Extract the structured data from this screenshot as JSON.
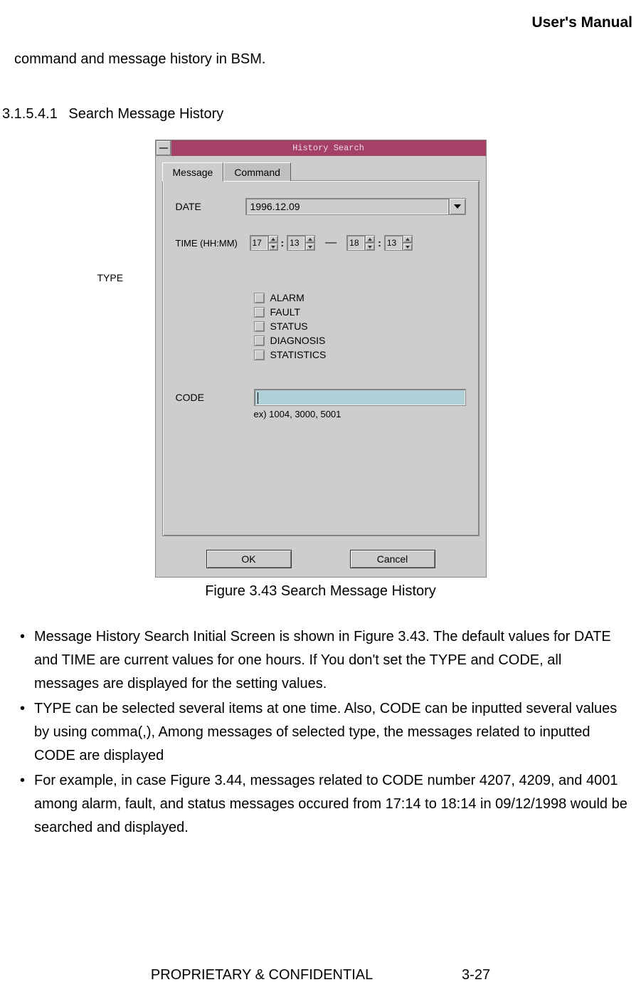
{
  "header": {
    "title": "User's Manual"
  },
  "intro": "command and message history in BSM.",
  "section": {
    "number": "3.1.5.4.1",
    "title": "Search Message History"
  },
  "window": {
    "title": "History Search",
    "tabs": [
      {
        "label": "Message",
        "active": true
      },
      {
        "label": "Command",
        "active": false
      }
    ],
    "form": {
      "date_label": "DATE",
      "date_value": "1996.12.09",
      "time_label": "TIME (HH:MM)",
      "time_from_hh": "17",
      "time_from_mm": "13",
      "time_sep": "—",
      "time_to_hh": "18",
      "time_to_mm": "13",
      "type_label": "TYPE",
      "types": [
        "ALARM",
        "FAULT",
        "STATUS",
        "DIAGNOSIS",
        "STATISTICS"
      ],
      "code_label": "CODE",
      "code_value": "",
      "code_hint": "ex) 1004, 3000, 5001"
    },
    "buttons": {
      "ok": "OK",
      "cancel": "Cancel"
    }
  },
  "figure_caption": "Figure 3.43 Search Message History",
  "bullets": [
    "Message History Search Initial Screen is shown in Figure 3.43. The default values for DATE and TIME are current values for one hours. If You don't set the TYPE and CODE, all messages are displayed for the setting values.",
    "TYPE can be selected several items at one time. Also, CODE can be inputted several values by using comma(,), Among messages of selected type, the messages related to inputted CODE are displayed",
    "For example, in case Figure 3.44, messages related to CODE number 4207, 4209, and 4001 among alarm, fault, and status messages occured from 17:14 to 18:14 in 09/12/1998 would be searched and displayed."
  ],
  "footer": {
    "left": "PROPRIETARY & CONFIDENTIAL",
    "right": "3-27"
  }
}
